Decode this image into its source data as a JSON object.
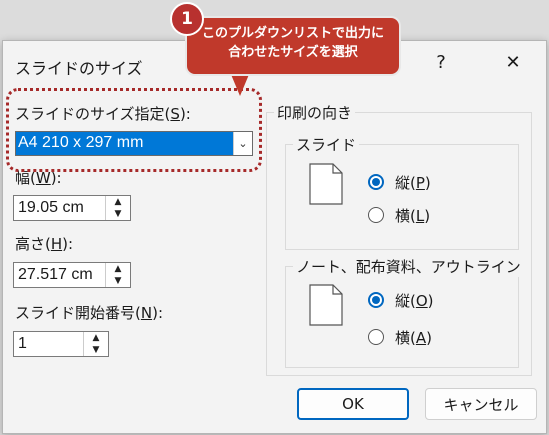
{
  "dialog": {
    "title": "スライドのサイズ",
    "help_label": "?",
    "close_label": "✕"
  },
  "slide_size": {
    "label_pre": "スライドのサイズ指定(",
    "label_key": "S",
    "label_post": "):",
    "value": "A4 210 x 297 mm"
  },
  "width": {
    "label_pre": "幅(",
    "label_key": "W",
    "label_post": "):",
    "value": "19.05 cm"
  },
  "height": {
    "label_pre": "高さ(",
    "label_key": "H",
    "label_post": "):",
    "value": "27.517 cm"
  },
  "start_number": {
    "label_pre": "スライド開始番号(",
    "label_key": "N",
    "label_post": "):",
    "value": "1"
  },
  "orientation": {
    "group_label": "印刷の向き",
    "slides": {
      "label": "スライド",
      "portrait_pre": "縦(",
      "portrait_key": "P",
      "portrait_post": ")",
      "portrait_selected": true,
      "landscape_pre": "横(",
      "landscape_key": "L",
      "landscape_post": ")"
    },
    "notes": {
      "label": "ノート、配布資料、アウトライン",
      "portrait_pre": "縦(",
      "portrait_key": "O",
      "portrait_post": ")",
      "portrait_selected": true,
      "landscape_pre": "横(",
      "landscape_key": "A",
      "landscape_post": ")"
    }
  },
  "buttons": {
    "ok": "OK",
    "cancel": "キャンセル"
  },
  "callout": {
    "number": "1",
    "line1": "このプルダウンリストで出力に",
    "line2": "合わせたサイズを選択",
    "color": "#c0392b"
  },
  "colors": {
    "accent": "#0067c0",
    "selection": "#0078d7"
  }
}
